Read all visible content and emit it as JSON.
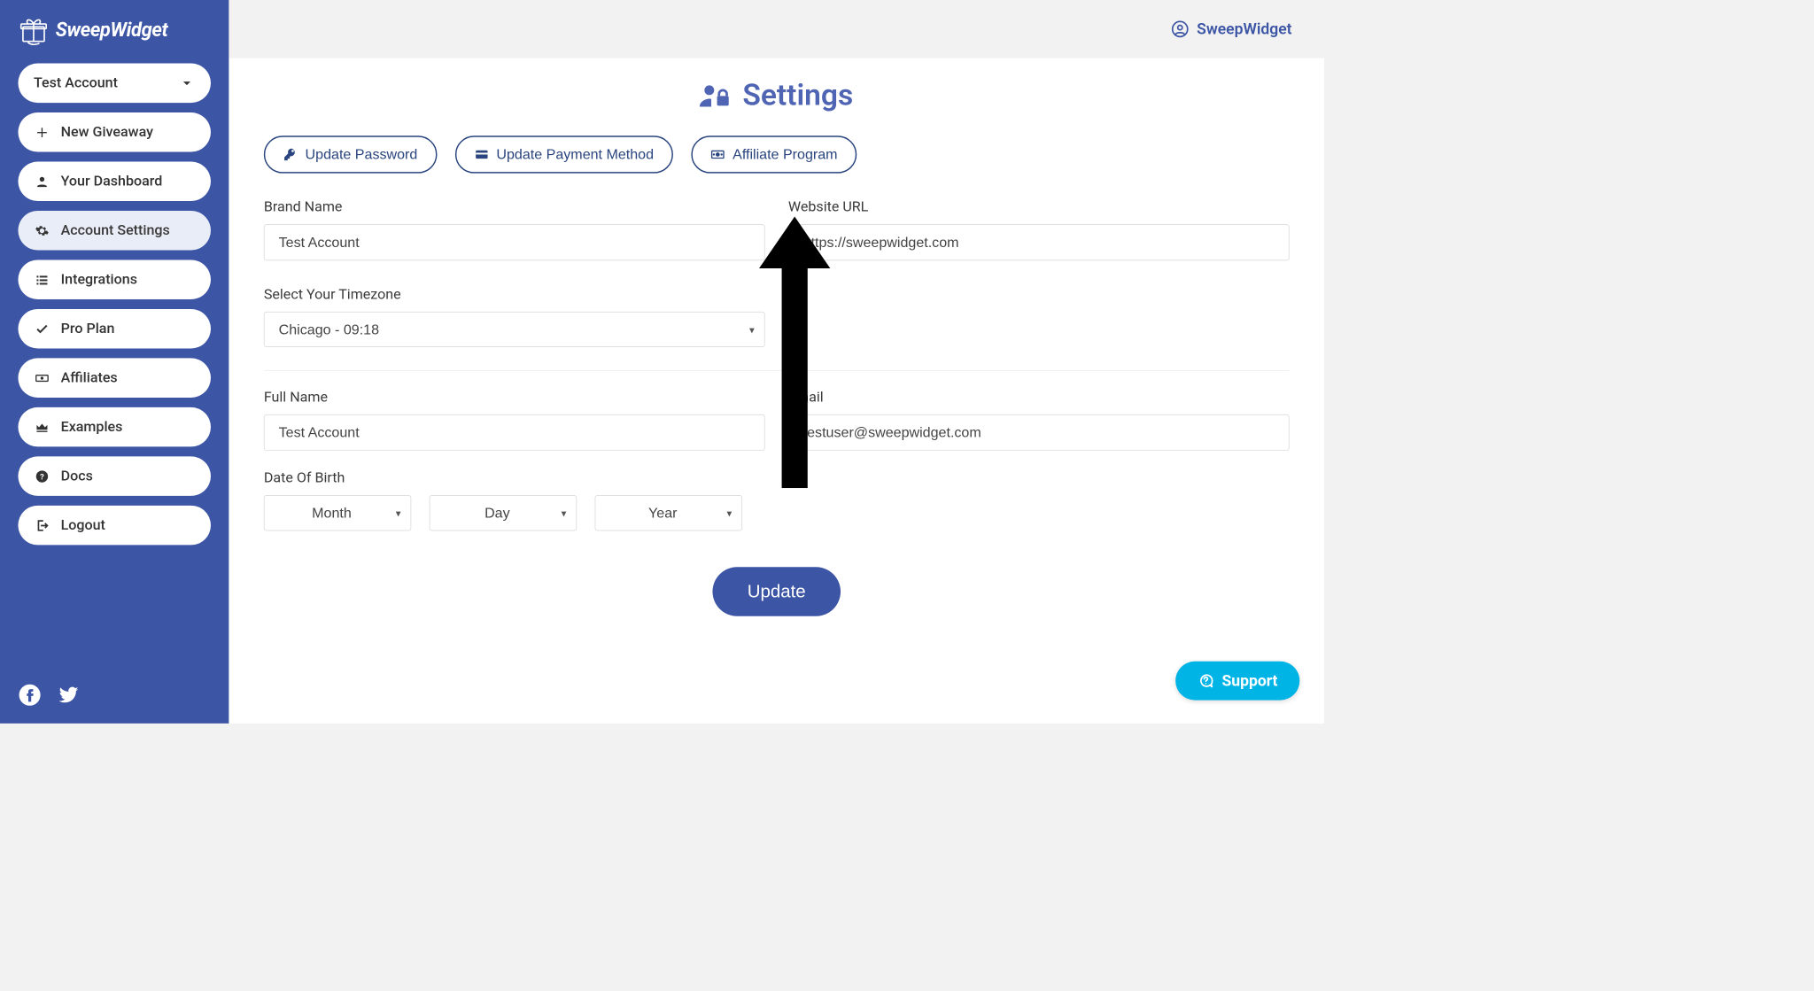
{
  "brand": "SweepWidget",
  "topbar": {
    "account_label": "SweepWidget"
  },
  "sidebar": {
    "account_selector": "Test Account",
    "items": [
      {
        "label": "New Giveaway",
        "icon": "plus-icon"
      },
      {
        "label": "Your Dashboard",
        "icon": "user-icon"
      },
      {
        "label": "Account Settings",
        "icon": "gear-icon",
        "active": true
      },
      {
        "label": "Integrations",
        "icon": "list-icon"
      },
      {
        "label": "Pro Plan",
        "icon": "check-icon"
      },
      {
        "label": "Affiliates",
        "icon": "money-icon"
      },
      {
        "label": "Examples",
        "icon": "crown-icon"
      },
      {
        "label": "Docs",
        "icon": "help-icon"
      },
      {
        "label": "Logout",
        "icon": "logout-icon"
      }
    ]
  },
  "page": {
    "title": "Settings"
  },
  "actions": {
    "update_password": "Update Password",
    "update_payment": "Update Payment Method",
    "affiliate_program": "Affiliate Program"
  },
  "form": {
    "brand_name_label": "Brand Name",
    "brand_name_value": "Test Account",
    "website_label": "Website URL",
    "website_value": "https://sweepwidget.com",
    "timezone_label": "Select Your Timezone",
    "timezone_value": "Chicago - 09:18",
    "full_name_label": "Full Name",
    "full_name_value": "Test Account",
    "email_label": "Email",
    "email_value": "testuser@sweepwidget.com",
    "dob_label": "Date Of Birth",
    "dob_month": "Month",
    "dob_day": "Day",
    "dob_year": "Year",
    "update_button": "Update"
  },
  "support": {
    "label": "Support"
  }
}
